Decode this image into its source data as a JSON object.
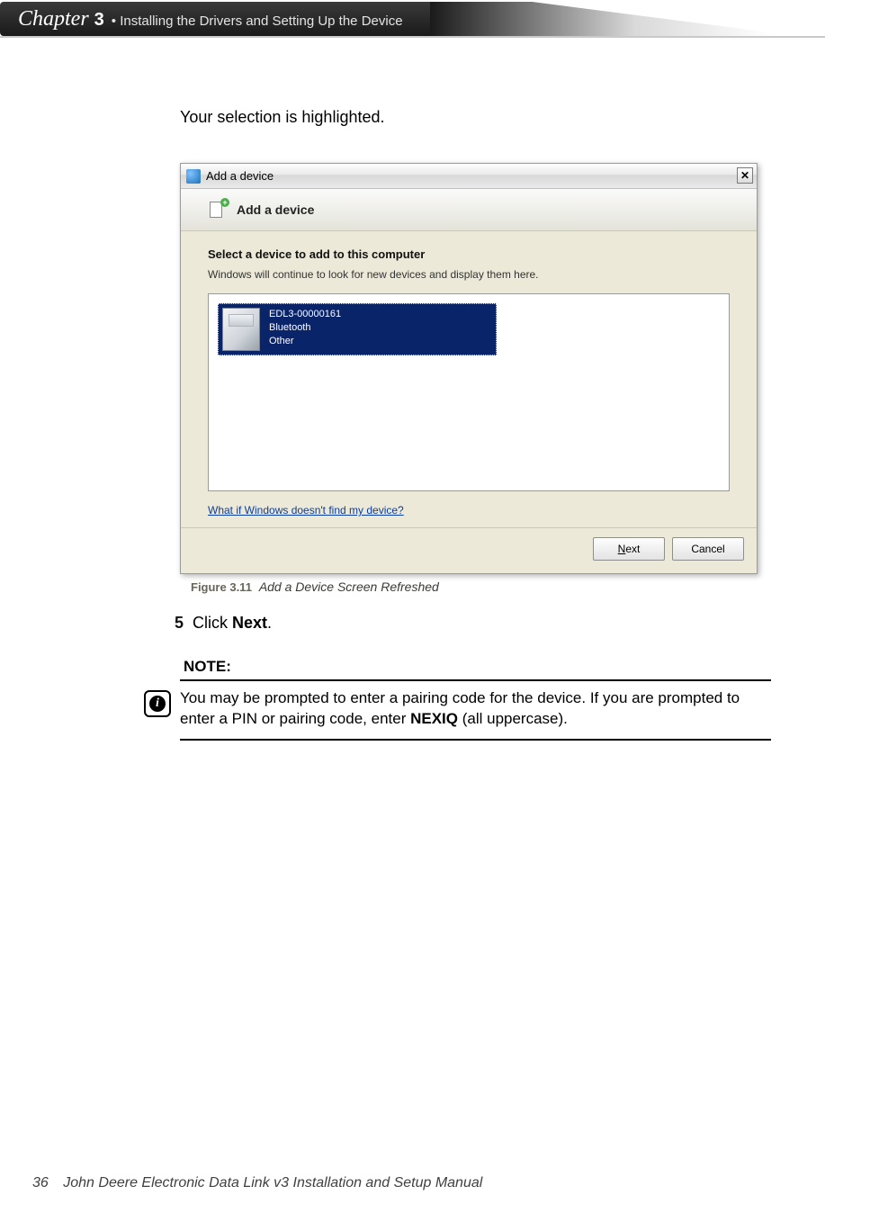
{
  "header": {
    "chapter_word": "Chapter",
    "chapter_number": "3",
    "chapter_title": "• Installing the Drivers and Setting Up the Device"
  },
  "intro": "Your selection is highlighted.",
  "screenshot": {
    "titlebar": "Add a device",
    "wizard_title": "Add a device",
    "heading": "Select a device to add to this computer",
    "subheading": "Windows will continue to look for new devices and display them here.",
    "device": {
      "line1": "EDL3-00000161",
      "line2": "Bluetooth",
      "line3": "Other"
    },
    "help_link": "What if Windows doesn't find my device?",
    "buttons": {
      "next_u": "N",
      "next_rest": "ext",
      "cancel": "Cancel"
    }
  },
  "figure": {
    "label": "Figure 3.11",
    "text": "Add a Device Screen Refreshed"
  },
  "step": {
    "number": "5",
    "pre": "Click ",
    "bold": "Next",
    "post": "."
  },
  "note": {
    "label": "NOTE:",
    "text_pre": "You may be prompted to enter a pairing code for the device. If you are prompted to enter a PIN or pairing code, enter ",
    "text_bold": "NEXIQ",
    "text_post": " (all uppercase)."
  },
  "footer": {
    "page": "36",
    "title": "John Deere Electronic Data Link v3 Installation and Setup Manual"
  }
}
